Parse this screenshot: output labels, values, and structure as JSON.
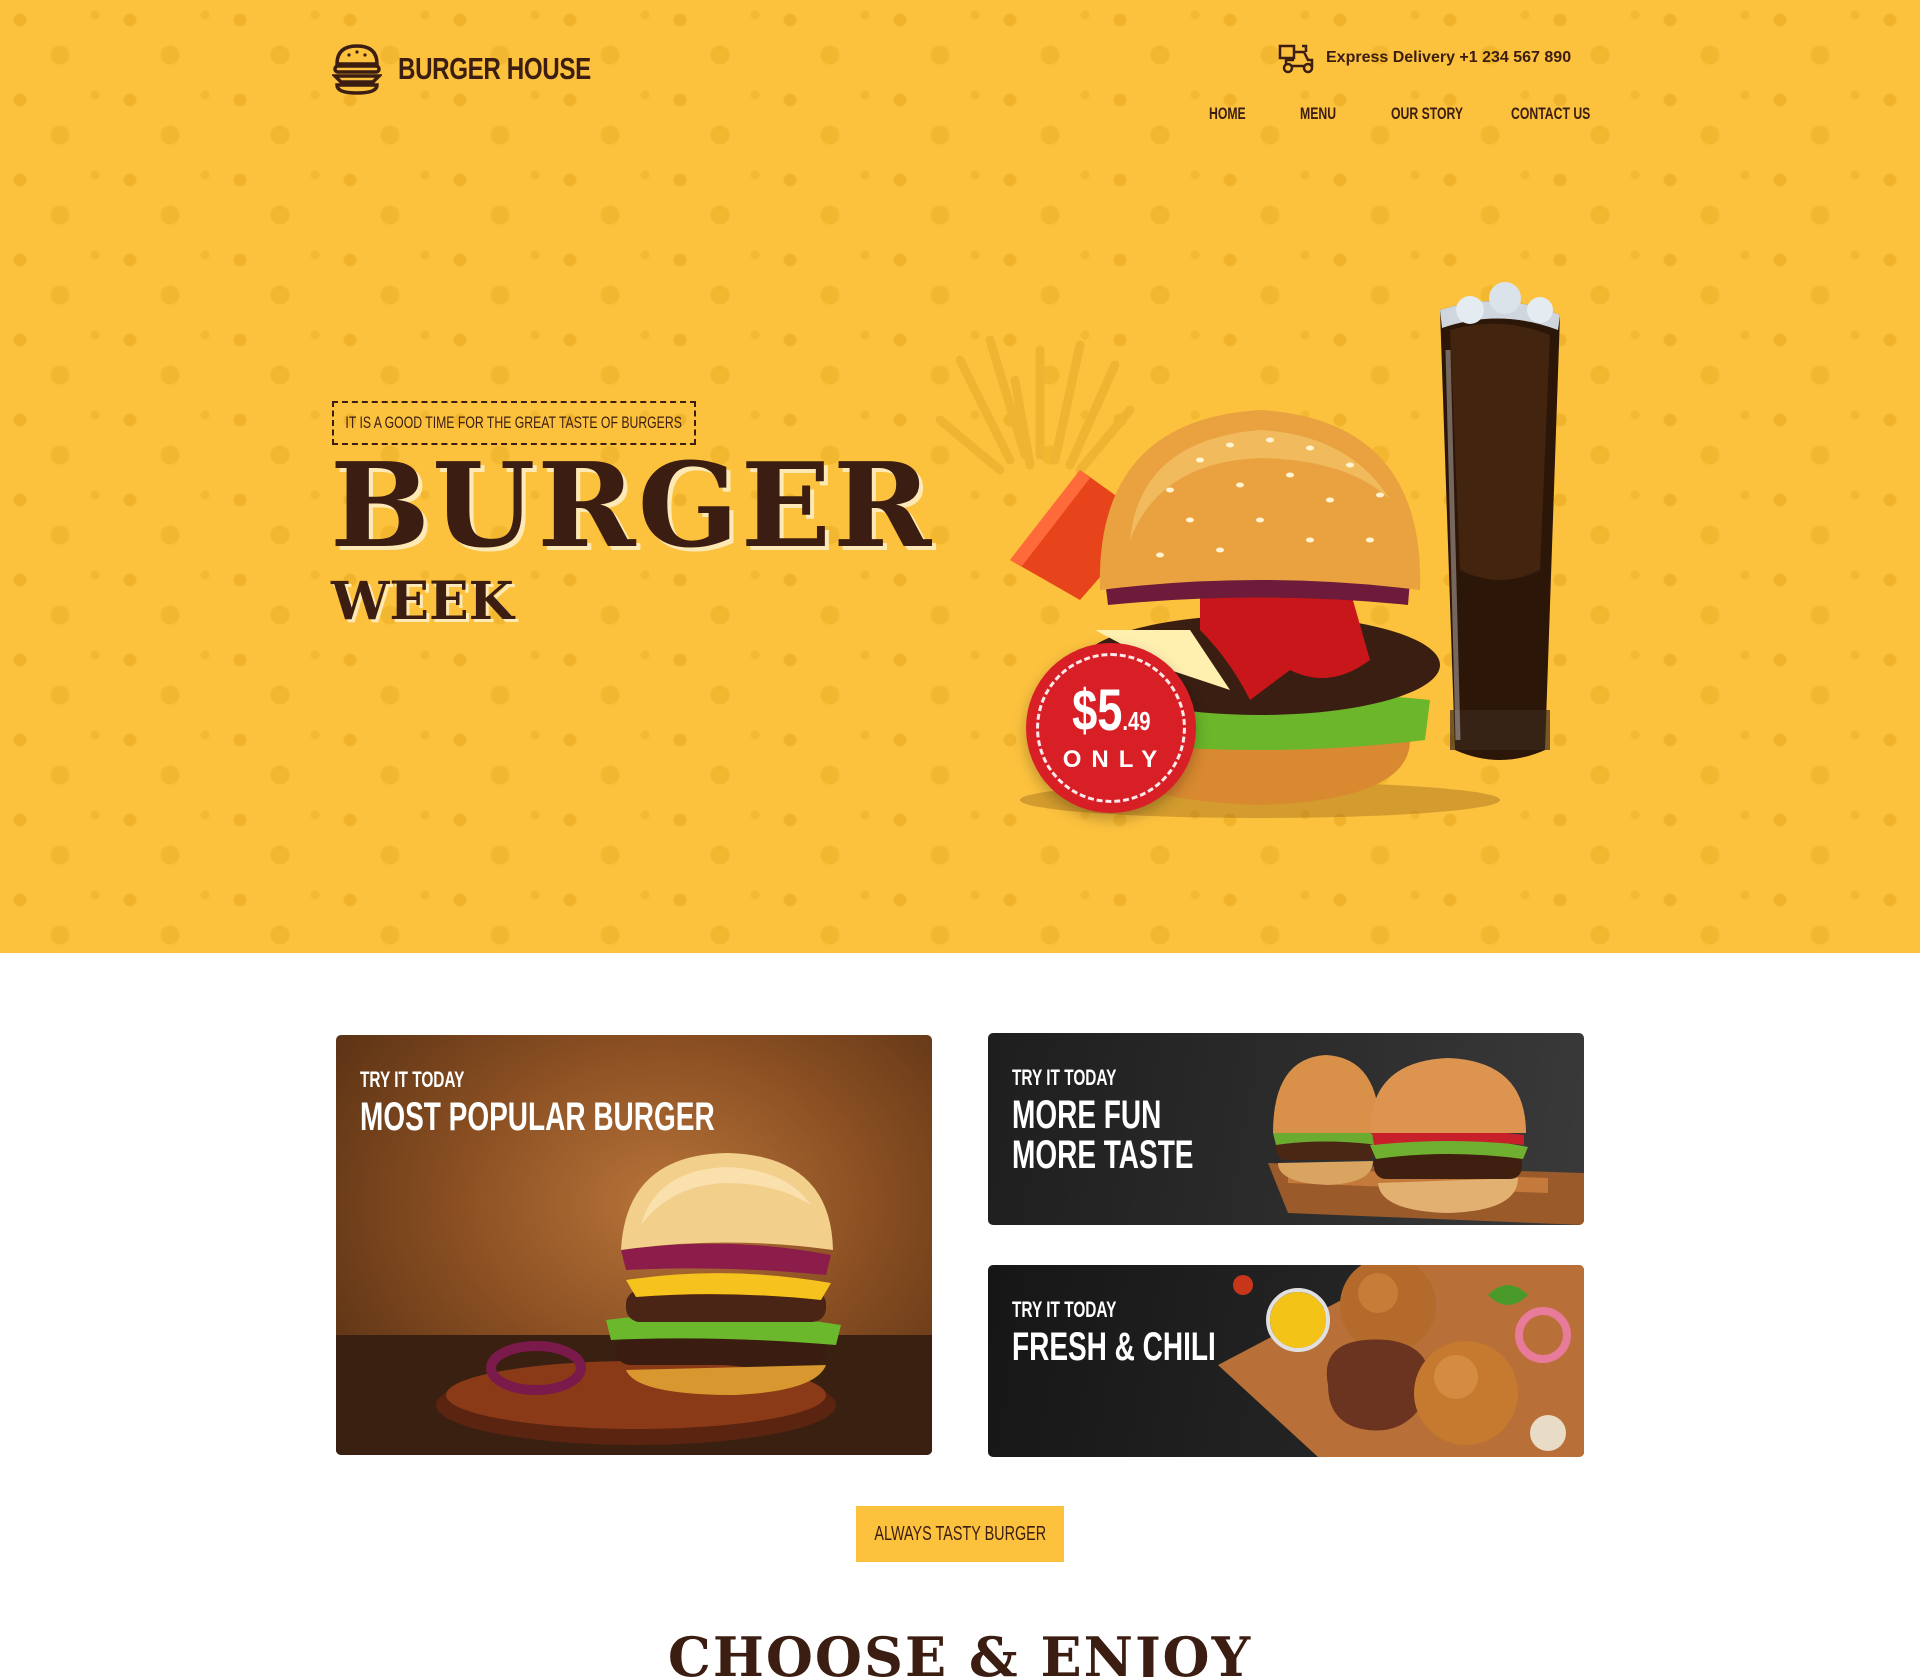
{
  "brand": {
    "name": "BURGER HOUSE"
  },
  "header": {
    "delivery_text": "Express Delivery +1 234 567 890",
    "nav": [
      {
        "label": "HOME"
      },
      {
        "label": "MENU"
      },
      {
        "label": "OUR STORY"
      },
      {
        "label": "CONTACT US"
      }
    ]
  },
  "hero": {
    "tagline": "IT IS A GOOD TIME FOR THE GREAT TASTE OF BURGERS",
    "title": "BURGER",
    "subtitle": "WEEK",
    "price": {
      "dollars": "$5",
      "cents": ".49",
      "note": "ONLY"
    }
  },
  "promos": [
    {
      "kicker": "TRY IT TODAY",
      "title": "MOST POPULAR BURGER"
    },
    {
      "kicker": "TRY IT TODAY",
      "title_line1": "MORE FUN",
      "title_line2": "MORE TASTE"
    },
    {
      "kicker": "TRY IT TODAY",
      "title": "FRESH & CHILI"
    }
  ],
  "cta": {
    "label": "ALWAYS TASTY BURGER"
  },
  "section": {
    "title": "CHOOSE & ENJOY"
  },
  "colors": {
    "primary_yellow": "#fcc23e",
    "brown": "#3b1d12",
    "badge_red": "#d91f26"
  },
  "icons": [
    "burger-logo-icon",
    "delivery-scooter-icon"
  ]
}
